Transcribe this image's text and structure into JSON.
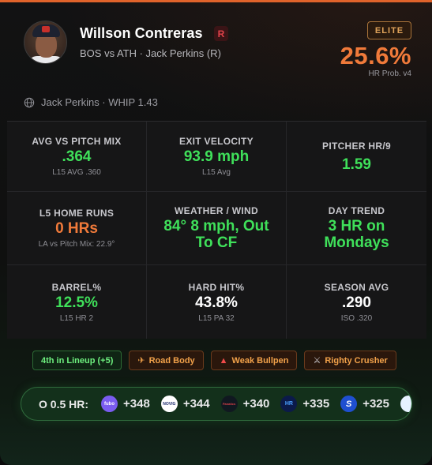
{
  "player": {
    "name": "Willson Contreras",
    "hand": "R",
    "matchup": "BOS vs ATH · Jack Perkins (R)"
  },
  "badge": "ELITE",
  "probability": {
    "value": "25.6%",
    "label": "HR Prob. v4"
  },
  "pitcher_line": "Jack Perkins · WHIP 1.43",
  "stats": [
    {
      "label": "AVG VS PITCH MIX",
      "value": ".364",
      "sub": "L15 AVG .360",
      "color": "green"
    },
    {
      "label": "EXIT VELOCITY",
      "value": "93.9 mph",
      "sub": "L15 Avg",
      "color": "green"
    },
    {
      "label": "PITCHER HR/9",
      "value": "1.59",
      "sub": "",
      "color": "green"
    },
    {
      "label": "L5 HOME RUNS",
      "value": "0 HRs",
      "sub": "LA vs Pitch Mix: 22.9°",
      "color": "orange"
    },
    {
      "label": "WEATHER / WIND",
      "value": "84° 8 mph, Out To CF",
      "sub": "",
      "color": "green"
    },
    {
      "label": "DAY TREND",
      "value": "3 HR on Mondays",
      "sub": "",
      "color": "green"
    },
    {
      "label": "BARREL%",
      "value": "12.5%",
      "sub": "L15 HR 2",
      "color": "green"
    },
    {
      "label": "HARD HIT%",
      "value": "43.8%",
      "sub": "L15 PA 32",
      "color": "white"
    },
    {
      "label": "SEASON AVG",
      "value": ".290",
      "sub": "ISO .320",
      "color": "white"
    }
  ],
  "tags": [
    {
      "label": "4th in Lineup (+5)",
      "style": "green",
      "icon": ""
    },
    {
      "label": "Road Body",
      "style": "orange",
      "icon": "plane-icon"
    },
    {
      "label": "Weak Bullpen",
      "style": "orange",
      "icon": "warning-icon"
    },
    {
      "label": "Righty Crusher",
      "style": "orange",
      "icon": "swords-icon"
    }
  ],
  "odds": {
    "label": "O 0.5 HR:",
    "books": [
      {
        "logo": "fubo",
        "logo_text": "fubo",
        "odds": "+348",
        "bg": "#7a5cf0",
        "fg": "#ffffff"
      },
      {
        "logo": "novig",
        "logo_text": "NOVIG",
        "odds": "+344",
        "bg": "#ffffff",
        "fg": "#1b2a6b"
      },
      {
        "logo": "fanatics",
        "logo_text": "Fanatics",
        "odds": "+340",
        "bg": "#101820",
        "fg": "#e0424a"
      },
      {
        "logo": "hard-rock",
        "logo_text": "HR",
        "odds": "+335",
        "bg": "#0b1a4a",
        "fg": "#4aa0ff"
      },
      {
        "logo": "sporttrade",
        "logo_text": "S",
        "odds": "+325",
        "bg": "#1f4fd0",
        "fg": "#ffffff"
      },
      {
        "logo": "book-6",
        "logo_text": "",
        "odds": "",
        "bg": "#e6f2ff",
        "fg": "#2060c0"
      }
    ]
  }
}
